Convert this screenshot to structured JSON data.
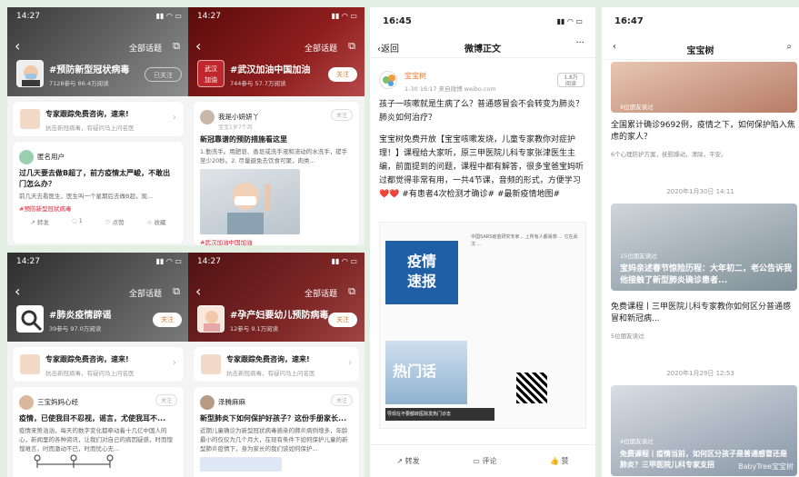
{
  "topic_cards": [
    {
      "time": "14:27",
      "title": "#预防新型冠状病毒",
      "stats": "7128参与 86.4万阅读",
      "nav": "全部话题",
      "follow": "已关注",
      "promo": {
        "title": "专家跟踪免费咨询，速来!",
        "sub": "抗击新冠病毒，有疑问马上问名医"
      },
      "post": {
        "user": "匿名用户",
        "utime": "",
        "title": "过几天要去做B超了，前方疫情太严峻，不敢出门怎么办？",
        "text": "前几天去看医生，医生叫一个星期后去做B超，现...",
        "tag": "#预防新型冠状病毒",
        "acts": [
          "转发",
          "1",
          "点赞",
          "收藏"
        ]
      }
    },
    {
      "time": "14:27",
      "title": "#武汉加油中国加油",
      "stats": "744参与 57.7万阅读",
      "nav": "全部话题",
      "follow": "关注",
      "promo": null,
      "post": {
        "user": "我是小妍妍丫",
        "utime": "宝宝1岁7个月",
        "title": "新冠靠谱的预防措施看这里",
        "text": "1.勤洗手。用肥皂、香皂或洗手液和流动的水洗手，搓手至少20秒。2. 尽量避免去饮食可聚，肉类...",
        "tag": "#武汉加油中国加油",
        "acts": []
      }
    },
    {
      "time": "14:27",
      "title": "#肺炎疫情辟谣",
      "stats": "39参与 97.0万阅读",
      "nav": "全部话题",
      "follow": "关注",
      "promo": {
        "title": "专家跟踪免费咨询，速来!",
        "sub": "抗击新冠病毒，有疑问马上问名医"
      },
      "post": {
        "user": "三宝妈妈心经",
        "utime": "",
        "title": "疫情，已使我目不忍视，谣言，尤使我耳不...",
        "text": "疫情来势汹汹，每天的数字变化都牵动着十几亿中国人的心，新闻里的各种资讯，让我们对自己的病因疑惑，时而惶惶难言，时而激动不已，时而忧心无...",
        "tag": "",
        "acts": []
      }
    },
    {
      "time": "14:27",
      "title": "#孕产妇要幼儿预防病毒",
      "stats": "12参与 9.1万阅读",
      "nav": "全部话题",
      "follow": "关注",
      "promo": {
        "title": "专家跟踪免费咨询，速来!",
        "sub": "抗击新冠病毒，有疑问马上问名医"
      },
      "post": {
        "user": "泽腾麻麻",
        "utime": "",
        "title": "新型肺炎下如何保护好孩子？这份手册家长...",
        "text": "近期儿童确诊为新型冠状病毒感染的肺炎病例增多，年龄最小的仅仅为几个月大，在现有条件下如何保护儿童的新型肺炎疫情下，身为家长的我们该如何保护...",
        "tag": "",
        "acts": []
      }
    }
  ],
  "middle": {
    "status_time": "16:45",
    "back": "返回",
    "title": "微博正文",
    "author": "宝宝树",
    "meta": "1-30 16:17 来自微博 weibo.com",
    "reads": "1.8万",
    "reads_label": "阅读",
    "paragraphs": [
      "孩子一咳嗽就是生病了么？普通感冒会不会转变为肺炎？肺炎如何治疗？",
      "宝宝树免费开放【宝宝咳嗽发烧，儿童专家教你对症护理！】课程给大家听，原三甲医院儿科专家张津医生主编，前面提到的问题，课程中都有解答，很多宝爸宝妈听过都觉得非常有用，一共4节课，音频的形式，方便学习 ❤️❤️ #有患者4次检测才确诊# #最新疫情地图#"
    ],
    "img_labels": {
      "a": "疫情",
      "b": "速报",
      "c": "热门话",
      "d": "导现在不要都转医院发热门诊去"
    },
    "actions": [
      "转发",
      "评论",
      "赞"
    ]
  },
  "right": {
    "status_time": "16:47",
    "title": "宝宝树",
    "items": [
      {
        "cap": "9位朋友读过",
        "title": "全国累计确诊9692例，疫情之下，如何保护陷入焦虑的家人？",
        "sub": "6个心理防护方案，抚慰躁动，清除，平安。"
      },
      {
        "date": "2020年1月30日 14:11",
        "cap": "15位朋友读过",
        "title": "宝妈亲述春节惊险历程：大年初二，老公告诉我他接触了新型肺炎确诊患者...",
        "sub": ""
      },
      {
        "cap": "",
        "title": "免费课程丨三甲医院儿科专家教你如何区分普通感冒和新冠病...",
        "sub": "5位朋友读过"
      },
      {
        "date": "2020年1月29日 12:53",
        "cap": "4位朋友读过",
        "title": "免费课程丨疫情当前，如何区分孩子是普通感冒还是肺炎？三甲医院儿科专家支招",
        "sub": ""
      }
    ],
    "watermark": "BabyTree宝宝树"
  }
}
